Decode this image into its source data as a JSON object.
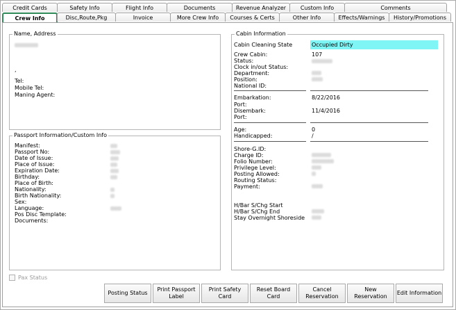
{
  "tabs_back": [
    "Credit Cards",
    "Safety Info",
    "Flight Info",
    "Documents",
    "Revenue Analyzer",
    "Custom Info",
    "Comments"
  ],
  "tabs_front": [
    "Crew Info",
    "Disc,Route,Pkg",
    "Invoice",
    "More Crew Info",
    "Courses & Certs",
    "Other Info",
    "Effects/Warnings",
    "History/Promotions"
  ],
  "name_address": {
    "legend": "Name, Address",
    "comma": ",",
    "tel": "Tel:",
    "mobile": "Mobile Tel:",
    "agent": "Maning Agent:"
  },
  "passport": {
    "legend": "Passport Information/Custom Info",
    "labels": [
      "Manifest:",
      "Passport No:",
      "Date of Issue:",
      "Place of Issue:",
      "Expiration Date:",
      "Birthday:",
      "Place of Birth:",
      "Nationality:",
      "Birth Nationality:",
      "Sex:",
      "Language:",
      "Pos Disc Template:",
      "Documents:"
    ]
  },
  "cabin": {
    "legend": "Cabin Information",
    "cleaning_label": "Cabin Cleaning State",
    "cleaning_value": "Occupied Dirty",
    "crew_cabin_label": "Crew Cabin:",
    "crew_cabin_value": "107",
    "labels_a": [
      "Status:",
      "Clock in/out Status:",
      "Department:",
      "Position:",
      "National ID:"
    ],
    "embark_label": "Embarkation:",
    "embark_value": "8/22/2016",
    "port1": "Port:",
    "disembark_label": "Disembark:",
    "disembark_value": "11/4/2016",
    "port2": "Port:",
    "age_label": "Age:",
    "age_value": "0",
    "handicapped_label": "Handicapped:",
    "handicapped_value": "/",
    "labels_b": [
      "Shore-G.ID:",
      "Charge ID:",
      "Folio Number:",
      "Privilege Level:",
      "Posting Allowed:",
      "Routing Status:",
      "Payment:"
    ],
    "labels_c": [
      "H/Bar S/Chg Start",
      "H/Bar S/Chg End",
      "Stay Overnight Shoreside"
    ]
  },
  "pax_status": "Pax Status",
  "buttons": [
    "Posting Status",
    "Print Passport Label",
    "Print Safety Card",
    "Reset Board Card",
    "Cancel Reservation",
    "New Reservation",
    "Edit Information"
  ],
  "colors": {
    "highlight": "#7ff5f5",
    "active_tab_border": "#2e8b57"
  }
}
